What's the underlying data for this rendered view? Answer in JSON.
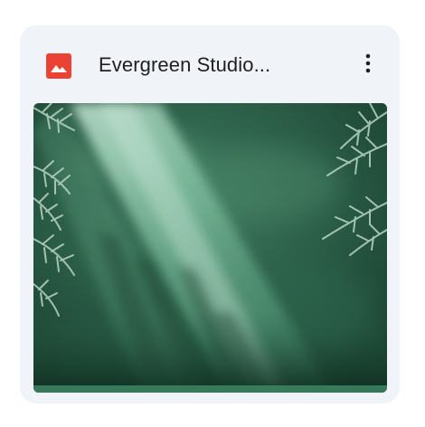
{
  "file_card": {
    "file_name": "Evergreen Studio...",
    "file_type_icon": "image-file-icon",
    "file_type_color": "#ea4335",
    "more_icon": "more-vertical-icon"
  },
  "thumbnail": {
    "description_icon": "image-thumbnail",
    "colors": {
      "base": "#1e4a37",
      "light": "#9fd8bc",
      "foliage": "#a7c7b5"
    }
  }
}
